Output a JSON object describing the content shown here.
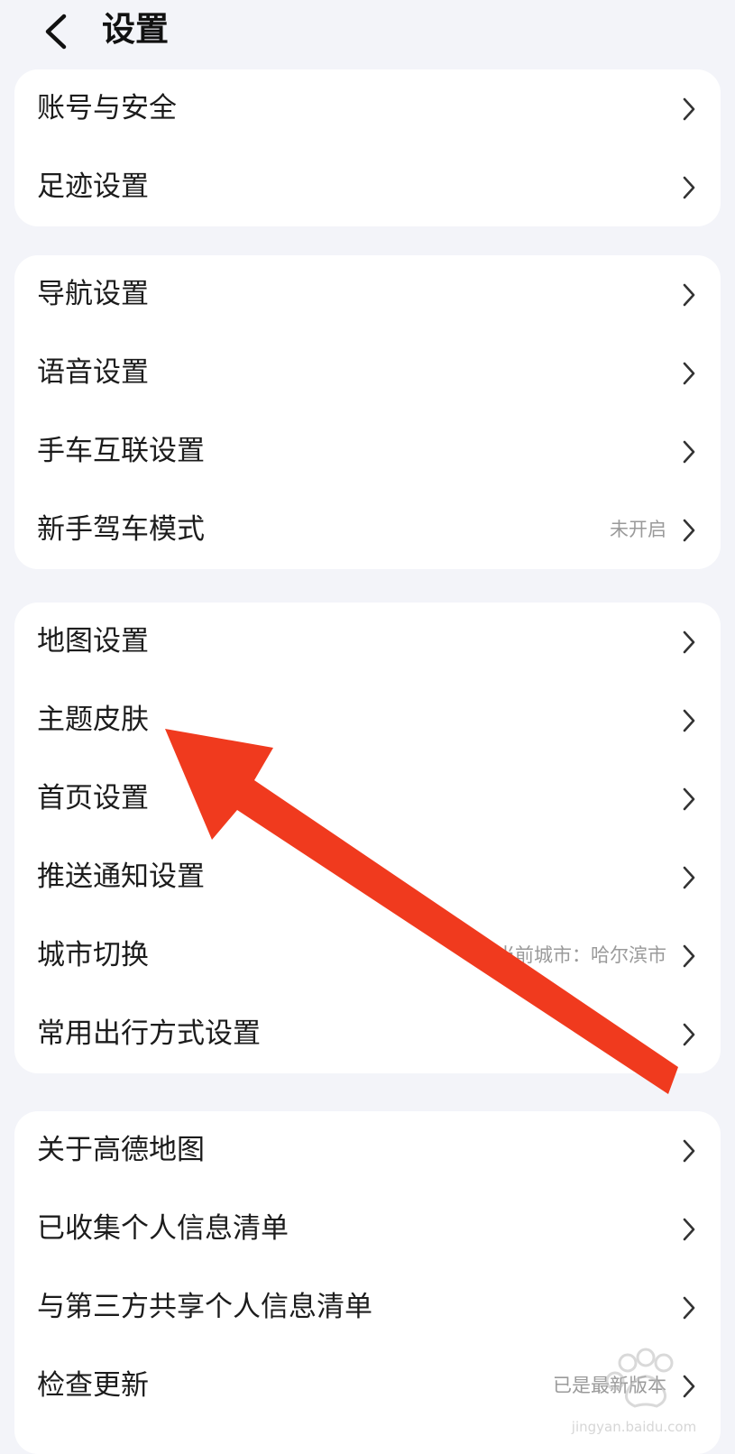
{
  "header": {
    "title": "设置",
    "back_icon": "chevron-left-icon"
  },
  "groups": [
    {
      "items": [
        {
          "label": "账号与安全",
          "value": ""
        },
        {
          "label": "足迹设置",
          "value": ""
        }
      ]
    },
    {
      "items": [
        {
          "label": "导航设置",
          "value": ""
        },
        {
          "label": "语音设置",
          "value": ""
        },
        {
          "label": "手车互联设置",
          "value": ""
        },
        {
          "label": "新手驾车模式",
          "value": "未开启"
        }
      ]
    },
    {
      "items": [
        {
          "label": "地图设置",
          "value": ""
        },
        {
          "label": "主题皮肤",
          "value": ""
        },
        {
          "label": "首页设置",
          "value": ""
        },
        {
          "label": "推送通知设置",
          "value": ""
        },
        {
          "label": "城市切换",
          "value": "当前城市：哈尔滨市"
        },
        {
          "label": "常用出行方式设置",
          "value": ""
        }
      ]
    },
    {
      "items": [
        {
          "label": "关于高德地图",
          "value": ""
        },
        {
          "label": "已收集个人信息清单",
          "value": ""
        },
        {
          "label": "与第三方共享个人信息清单",
          "value": ""
        },
        {
          "label": "检查更新",
          "value": "已是最新版本"
        }
      ]
    }
  ],
  "annotation": {
    "arrow_color": "#f03a1e",
    "icon": "red-arrow-pointer"
  },
  "watermark": {
    "text": "jingyan.baidu.com"
  }
}
